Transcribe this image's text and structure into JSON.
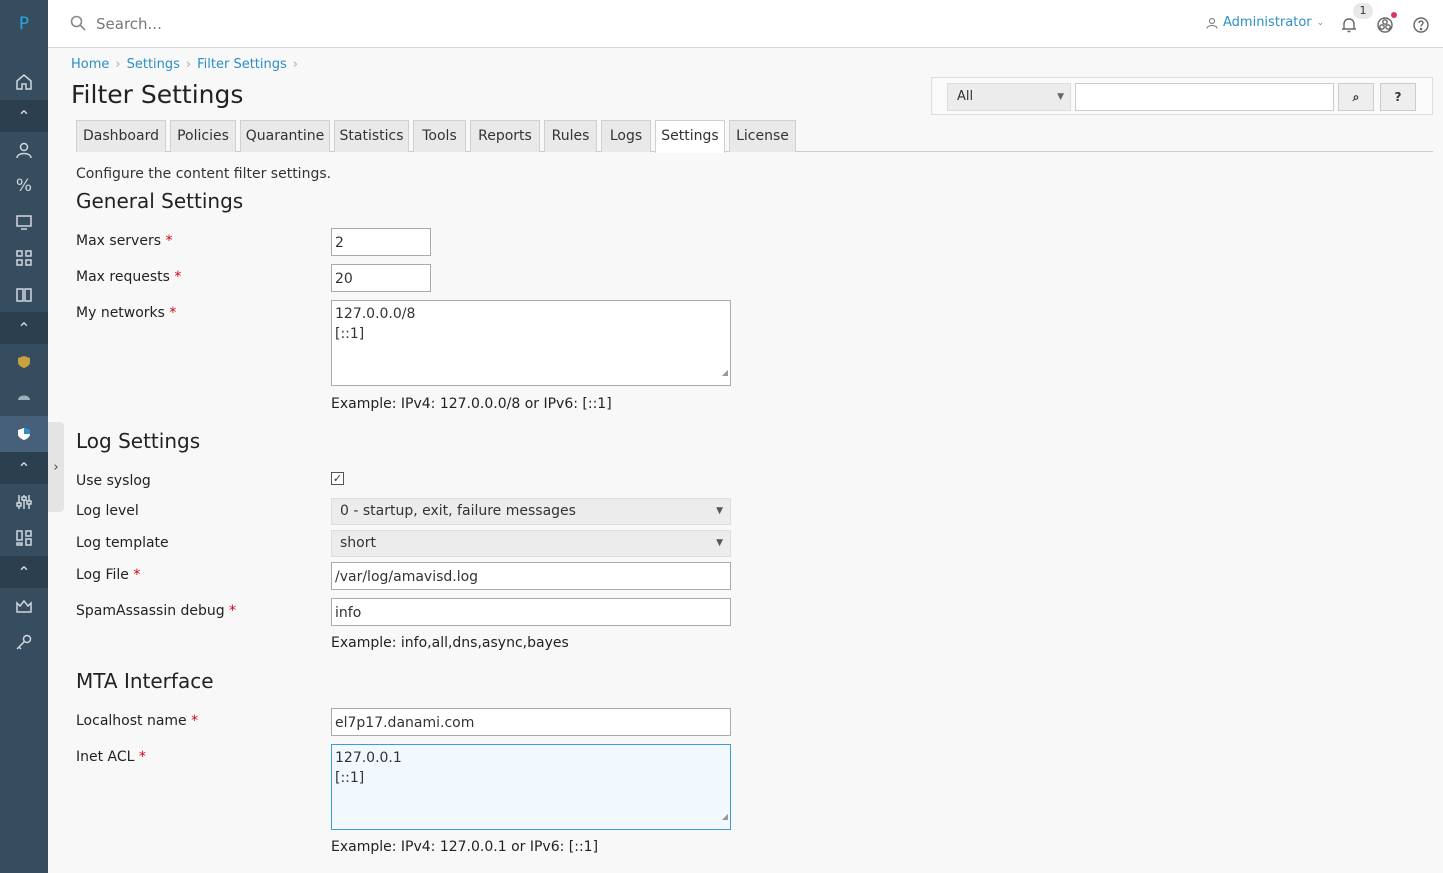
{
  "app": {
    "logo": "P"
  },
  "search": {
    "placeholder": "Search..."
  },
  "user": {
    "name": "Administrator",
    "notifications": "1"
  },
  "breadcrumb": [
    "Home",
    "Settings",
    "Filter Settings"
  ],
  "page": {
    "title": "Filter Settings",
    "description": "Configure the content filter settings."
  },
  "topsearch": {
    "scope": "All",
    "go": "⌕",
    "help": "?"
  },
  "tabs": [
    "Dashboard",
    "Policies",
    "Quarantine",
    "Statistics",
    "Tools",
    "Reports",
    "Rules",
    "Logs",
    "Settings",
    "License"
  ],
  "active_tab": "Settings",
  "general": {
    "heading": "General Settings",
    "max_servers": {
      "label": "Max servers",
      "value": "2"
    },
    "max_requests": {
      "label": "Max requests",
      "value": "20"
    },
    "my_networks": {
      "label": "My networks",
      "line1": "127.0.0.0/8",
      "line2": "[::1]",
      "hint": "Example: IPv4: 127.0.0.0/8 or IPv6: [::1]"
    }
  },
  "log": {
    "heading": "Log Settings",
    "use_syslog": {
      "label": "Use syslog",
      "checked": true
    },
    "log_level": {
      "label": "Log level",
      "value": "0 - startup, exit, failure messages"
    },
    "log_template": {
      "label": "Log template",
      "value": "short"
    },
    "log_file": {
      "label": "Log File",
      "value": "/var/log/amavisd.log"
    },
    "sa_debug": {
      "label": "SpamAssassin debug",
      "value": "info",
      "hint": "Example: info,all,dns,async,bayes"
    }
  },
  "mta": {
    "heading": "MTA Interface",
    "localhost": {
      "label": "Localhost name",
      "value": "el7p17.danami.com"
    },
    "inet_acl": {
      "label": "Inet ACL",
      "line1": "127.0.0.1",
      "line2": "[::1]",
      "hint": "Example: IPv4: 127.0.0.1 or IPv6: [::1]"
    }
  },
  "colors": {
    "sidebar": "#364d5f",
    "accent": "#2b8fc5",
    "required": "#d0021b"
  }
}
